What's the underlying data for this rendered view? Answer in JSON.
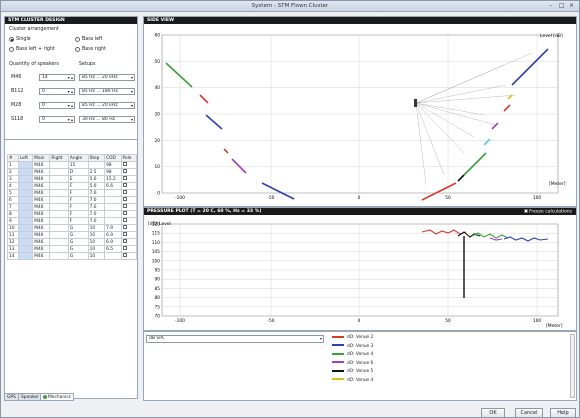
{
  "window": {
    "title": "System - STM Flown Cluster"
  },
  "design": {
    "header": "STM CLUSTER DESIGN",
    "cluster_label": "Cluster arrangement",
    "radios": [
      {
        "label": "Single",
        "on": true
      },
      {
        "label": "Bass left",
        "on": false
      },
      {
        "label": "Bass left + right",
        "on": false
      },
      {
        "label": "Bass right",
        "on": false
      }
    ],
    "quantity_label": "Quantity of speakers",
    "setups_label": "Setups",
    "rows": [
      {
        "name": "M46",
        "qty": "14",
        "setup": "85 Hz ... 20 kHz"
      },
      {
        "name": "B112",
        "qty": "0",
        "setup": "85 Hz ... 180 Hz"
      },
      {
        "name": "M28",
        "qty": "0",
        "setup": "85 Hz ... 20 kHz"
      },
      {
        "name": "S118",
        "qty": "0",
        "setup": "30 Hz ... 80 Hz"
      }
    ]
  },
  "table": {
    "headers": [
      "#",
      "Left",
      "Main",
      "Right",
      "Angle",
      "Step",
      "COD",
      "Pole"
    ],
    "rows": [
      [
        "1",
        "",
        "M46",
        "",
        "15",
        "",
        "98"
      ],
      [
        "2",
        "",
        "M46",
        "",
        "D",
        "2.5",
        "98"
      ],
      [
        "3",
        "",
        "M46",
        "",
        "E",
        "5.0",
        "15.2",
        "98"
      ],
      [
        "4",
        "",
        "M46",
        "",
        "F",
        "5.0",
        "6.6",
        "98"
      ],
      [
        "5",
        "",
        "M46",
        "",
        "F",
        "7.0",
        "",
        "98"
      ],
      [
        "6",
        "",
        "M46",
        "",
        "F",
        "7.0",
        "",
        "98"
      ],
      [
        "7",
        "",
        "M46",
        "",
        "F",
        "7.0",
        "",
        "98"
      ],
      [
        "8",
        "",
        "M46",
        "",
        "F",
        "7.0",
        "",
        "98"
      ],
      [
        "9",
        "",
        "M46",
        "",
        "F",
        "7.0",
        "",
        "98"
      ],
      [
        "10",
        "",
        "M46",
        "",
        "G",
        "10",
        "7.9",
        "98"
      ],
      [
        "11",
        "",
        "M46",
        "",
        "G",
        "10",
        "6.9",
        "98"
      ],
      [
        "12",
        "",
        "M46",
        "",
        "G",
        "10",
        "6.9",
        "98"
      ],
      [
        "13",
        "",
        "M46",
        "",
        "G",
        "10",
        "6.5",
        "98"
      ],
      [
        "14",
        "",
        "M46",
        "",
        "G",
        "10",
        "",
        "98"
      ]
    ]
  },
  "tabs": [
    "GPS",
    "Speaker",
    "Mechanics"
  ],
  "side_view": {
    "header": "SIDE VIEW",
    "unit_y": "Level [dB]",
    "unit_x": "[Meter]",
    "yticks": [
      "60",
      "50",
      "40",
      "30",
      "20",
      "10",
      "0"
    ],
    "xticks": [
      "-100",
      "-50",
      "0",
      "50",
      "100"
    ]
  },
  "pressure": {
    "header": "PRESSURE PLOT  (T = 20 C, 60 %, Hz = 33 %)",
    "freeze": "Freeze calculations",
    "unit_y": "[dB]  Level",
    "unit_x": "[Meter]",
    "yticks": [
      "120",
      "115",
      "110",
      "105",
      "100",
      "95",
      "90",
      "85",
      "80",
      "75",
      "70"
    ],
    "xticks": [
      "-100",
      "-50",
      "0",
      "50",
      "100"
    ]
  },
  "bottom": {
    "dropdown": "dB SPL",
    "legend": [
      {
        "label": "dO: Venue 2",
        "color": "#d63a2a"
      },
      {
        "label": "dO: Venue 3",
        "color": "#2f3faf"
      },
      {
        "label": "dO: Venue 4",
        "color": "#3aa03a"
      },
      {
        "label": "dO: Venue 6",
        "color": "#a33cbf"
      },
      {
        "label": "dO: Venue 5",
        "color": "#111111"
      },
      {
        "label": "dO: Venue 4",
        "color": "#e0c020"
      }
    ]
  },
  "buttons": {
    "ok": "OK",
    "cancel": "Cancel",
    "help": "Help"
  }
}
